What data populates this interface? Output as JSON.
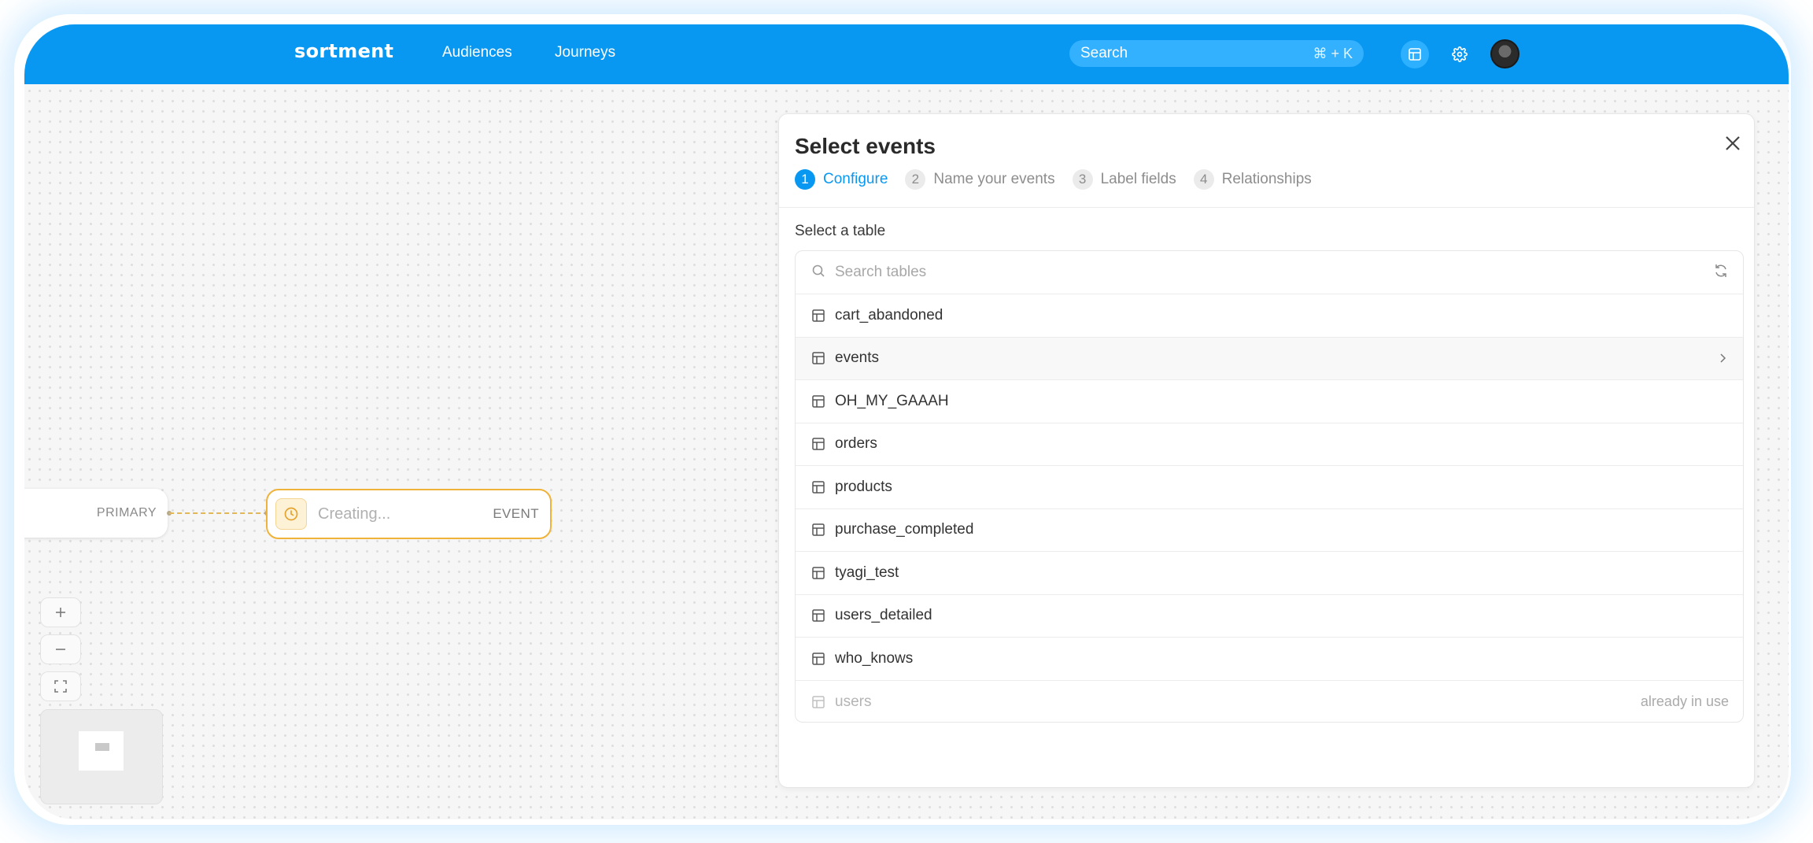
{
  "app": {
    "logo": "sortment",
    "nav": [
      {
        "label": "Audiences"
      },
      {
        "label": "Journeys"
      }
    ],
    "search": {
      "placeholder": "Search",
      "shortcut": "⌘ + K"
    },
    "icons": [
      "table-icon",
      "gear-icon",
      "avatar"
    ],
    "accent_color": "#0898f2"
  },
  "canvas": {
    "primary_node": {
      "type_label": "PRIMARY"
    },
    "event_node": {
      "name": "Creating...",
      "type_label": "EVENT",
      "icon": "clock-icon"
    },
    "zoom_controls": [
      "zoom-in",
      "zoom-out",
      "fit-view"
    ]
  },
  "panel": {
    "title": "Select events",
    "steps": [
      {
        "num": "1",
        "label": "Configure",
        "active": true
      },
      {
        "num": "2",
        "label": "Name your events"
      },
      {
        "num": "3",
        "label": "Label fields"
      },
      {
        "num": "4",
        "label": "Relationships"
      }
    ],
    "section_label": "Select a table",
    "table_search": {
      "placeholder": "Search tables"
    },
    "tables": [
      {
        "name": "cart_abandoned"
      },
      {
        "name": "events",
        "hovered": true
      },
      {
        "name": "OH_MY_GAAAH"
      },
      {
        "name": "orders"
      },
      {
        "name": "products"
      },
      {
        "name": "purchase_completed"
      },
      {
        "name": "tyagi_test"
      },
      {
        "name": "users_detailed"
      },
      {
        "name": "who_knows"
      },
      {
        "name": "users",
        "disabled": true,
        "note": "already in use"
      }
    ]
  }
}
